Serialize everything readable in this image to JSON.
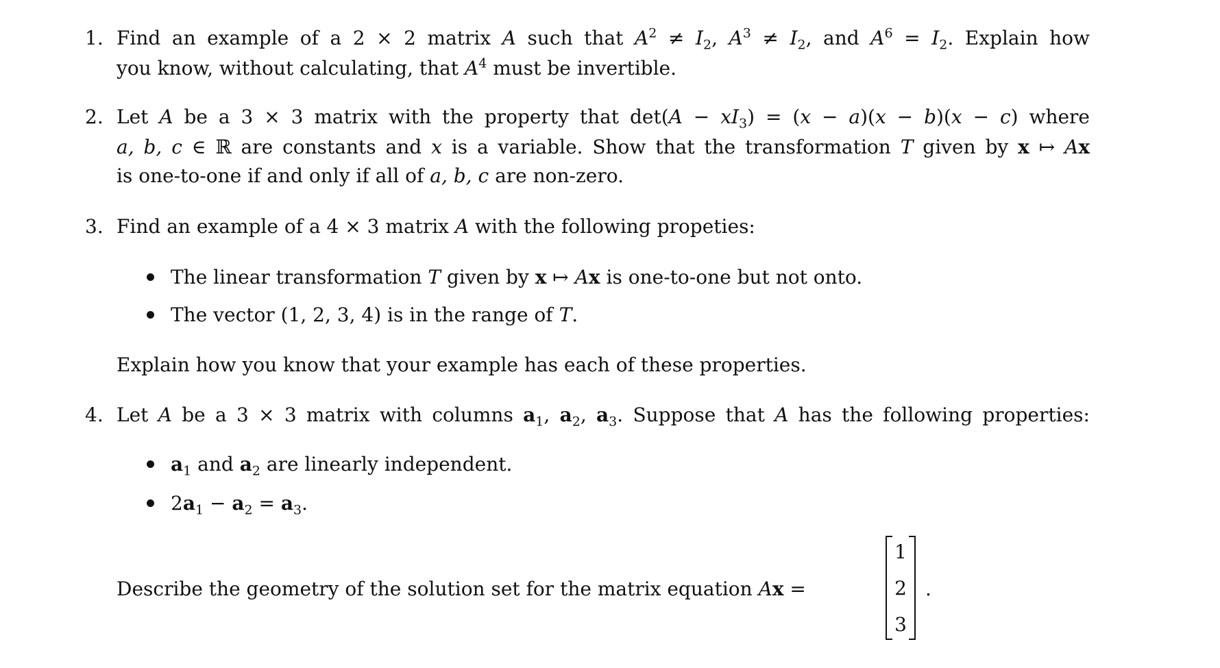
{
  "problems": [
    {
      "number": "1.",
      "lines": [
        {
          "parts": [
            "Find an example of a 2 × 2 matrix ",
            "A",
            " such that ",
            "A",
            "2",
            " ≠ ",
            "I",
            "2",
            ", ",
            "A",
            "3",
            " ≠ ",
            "I",
            "2",
            ", and ",
            "A",
            "6",
            " = ",
            "I",
            "2",
            ". Explain how"
          ]
        },
        {
          "parts": [
            "you know, without calculating, that ",
            "A",
            "4",
            " must be invertible."
          ]
        }
      ]
    },
    {
      "number": "2.",
      "lines": [
        {
          "parts": [
            "Let ",
            "A",
            " be a 3 × 3 matrix with the property that det(",
            "A",
            " − ",
            "x",
            "I",
            "3",
            ") = (",
            "x",
            " − ",
            "a",
            ")(",
            "x",
            " − ",
            "b",
            ")(",
            "x",
            " − ",
            "c",
            ") where"
          ]
        },
        {
          "parts": [
            "a, b, c",
            " ∈ ℝ are constants and ",
            "x",
            " is a variable. Show that the transformation ",
            "T",
            " given by ",
            "x",
            " ↦ ",
            "A",
            "x"
          ]
        },
        {
          "parts": [
            "is one-to-one if and only if all of ",
            "a, b, c",
            " are non-zero."
          ]
        }
      ]
    },
    {
      "number": "3.",
      "lines": [
        {
          "parts": [
            "Find an example of a 4 × 3 matrix ",
            "A",
            " with the following propeties:"
          ]
        }
      ],
      "bullets": [
        {
          "parts": [
            "The linear transformation ",
            "T",
            " given by ",
            "x",
            " ↦ ",
            "A",
            "x",
            " is one-to-one but not onto."
          ]
        },
        {
          "parts": [
            "The vector (1, 2, 3, 4) is in the range of ",
            "T",
            "."
          ]
        }
      ],
      "closing": "Explain how you know that your example has each of these properties."
    },
    {
      "number": "4.",
      "lines": [
        {
          "parts": [
            "Let ",
            "A",
            " be a 3 × 3 matrix with columns ",
            "a",
            "1",
            ", ",
            "a",
            "2",
            ", ",
            "a",
            "3",
            ". Suppose that ",
            "A",
            " has the following properties:"
          ]
        }
      ],
      "bullets": [
        {
          "parts": [
            "a",
            "1",
            " and ",
            "a",
            "2",
            " are linearly independent."
          ]
        },
        {
          "parts": [
            "2",
            "a",
            "1",
            " − ",
            "a",
            "2",
            " = ",
            "a",
            "3",
            "."
          ]
        }
      ],
      "closing_parts": [
        "Describe the geometry of the solution set for the matrix equation ",
        "A",
        "x",
        " = "
      ],
      "vector": [
        "1",
        "2",
        "3"
      ],
      "end": "."
    }
  ]
}
